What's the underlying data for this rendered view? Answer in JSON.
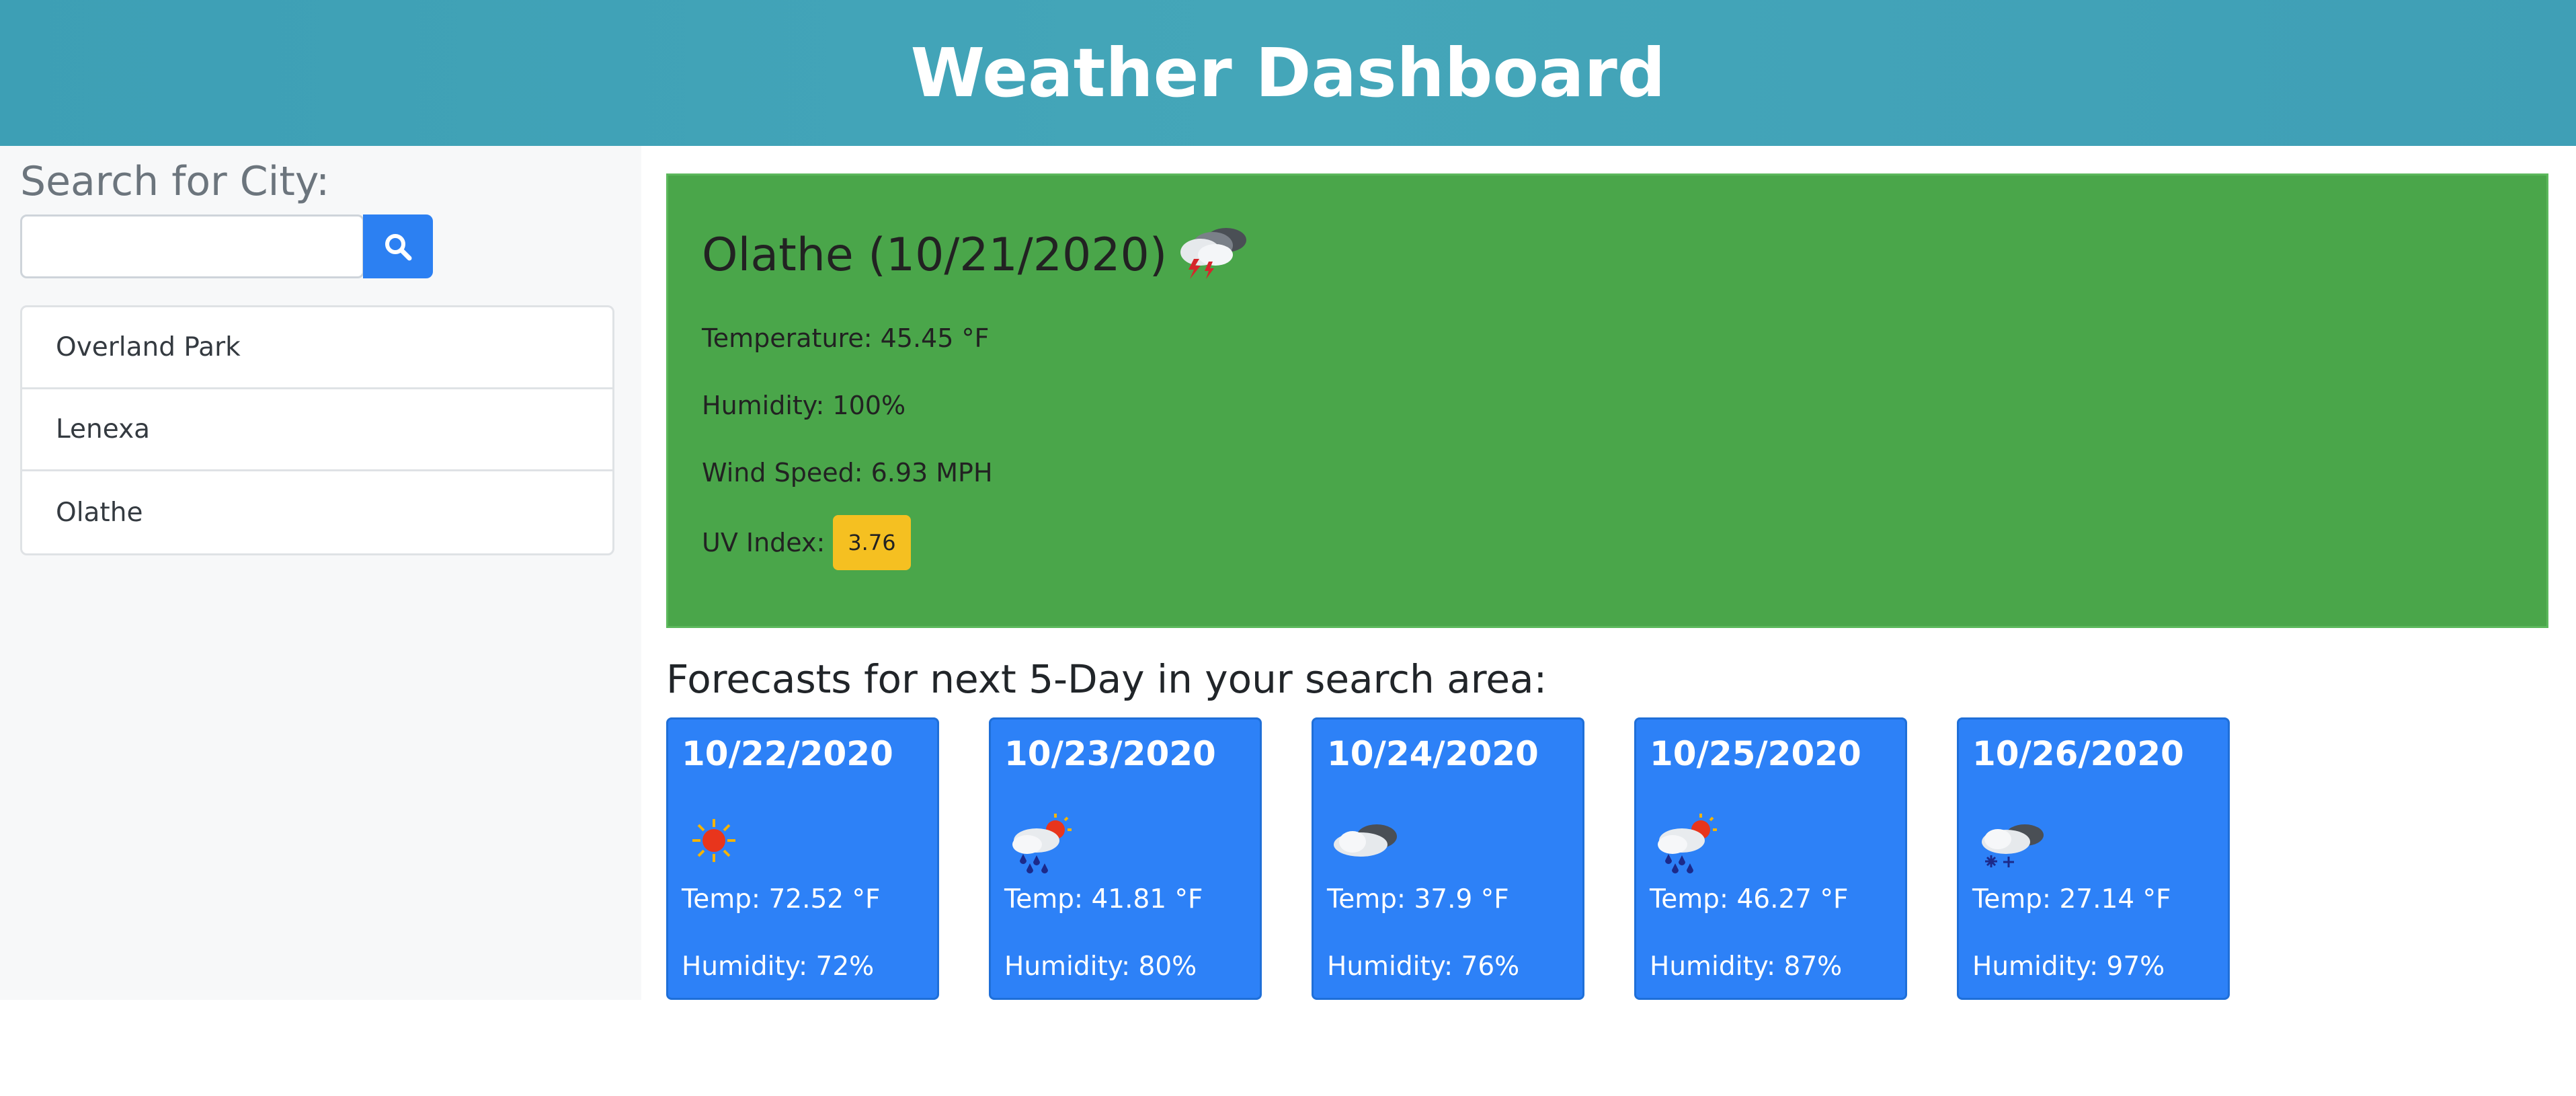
{
  "header": {
    "title": "Weather Dashboard"
  },
  "search": {
    "label": "Search for City:",
    "input_value": "",
    "placeholder": ""
  },
  "history": {
    "items": [
      "Overland Park",
      "Lenexa",
      "Olathe"
    ]
  },
  "current": {
    "title": "Olathe (10/21/2020)",
    "icon": "thunderstorm-icon",
    "temperature": "Temperature: 45.45 °F",
    "humidity": "Humidity: 100%",
    "wind": "Wind Speed: 6.93 MPH",
    "uv_label": "UV Index:",
    "uv_value": "3.76",
    "uv_color": "#f5c021",
    "bg_color": "#4aa64a"
  },
  "forecast": {
    "title": "Forecasts for next 5-Day in your search area:",
    "card_color": "#2d81f7",
    "days": [
      {
        "date": "10/22/2020",
        "icon": "sun-icon",
        "temp": "Temp: 72.52 °F",
        "humidity": "Humidity: 72%"
      },
      {
        "date": "10/23/2020",
        "icon": "rain-sun-icon",
        "temp": "Temp: 41.81 °F",
        "humidity": "Humidity: 80%"
      },
      {
        "date": "10/24/2020",
        "icon": "cloud-icon",
        "temp": "Temp: 37.9 °F",
        "humidity": "Humidity: 76%"
      },
      {
        "date": "10/25/2020",
        "icon": "rain-sun-icon",
        "temp": "Temp: 46.27 °F",
        "humidity": "Humidity: 87%"
      },
      {
        "date": "10/26/2020",
        "icon": "snow-cloud-icon",
        "temp": "Temp: 27.14 °F",
        "humidity": "Humidity: 97%"
      }
    ]
  }
}
